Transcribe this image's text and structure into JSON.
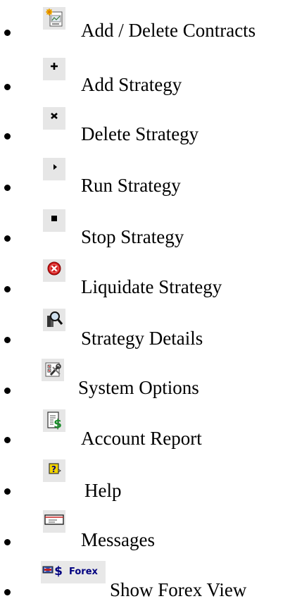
{
  "items": [
    {
      "label": "Add / Delete Contracts",
      "icon": "add-delete-contracts-icon"
    },
    {
      "label": "Add Strategy",
      "icon": "plus-icon"
    },
    {
      "label": "Delete Strategy",
      "icon": "delete-x-icon"
    },
    {
      "label": "Run Strategy",
      "icon": "play-triangle-icon"
    },
    {
      "label": "Stop Strategy",
      "icon": "stop-square-icon"
    },
    {
      "label": "Liquidate Strategy",
      "icon": "red-x-circle-icon"
    },
    {
      "label": "Strategy Details",
      "icon": "magnifier-icon"
    },
    {
      "label": "System Options",
      "icon": "options-wrench-icon"
    },
    {
      "label": "Account Report",
      "icon": "dollar-report-icon"
    },
    {
      "label": "Help",
      "icon": "question-help-icon"
    },
    {
      "label": "Messages",
      "icon": "envelope-icon"
    },
    {
      "label": "Show Forex View",
      "icon": "forex-icon",
      "icon_text": "Forex"
    }
  ],
  "colors": {
    "icon_background": "#e6e6e6",
    "liquidate_red": "#d01818",
    "report_green": "#1a8c2a",
    "forex_blue": "#000080"
  }
}
